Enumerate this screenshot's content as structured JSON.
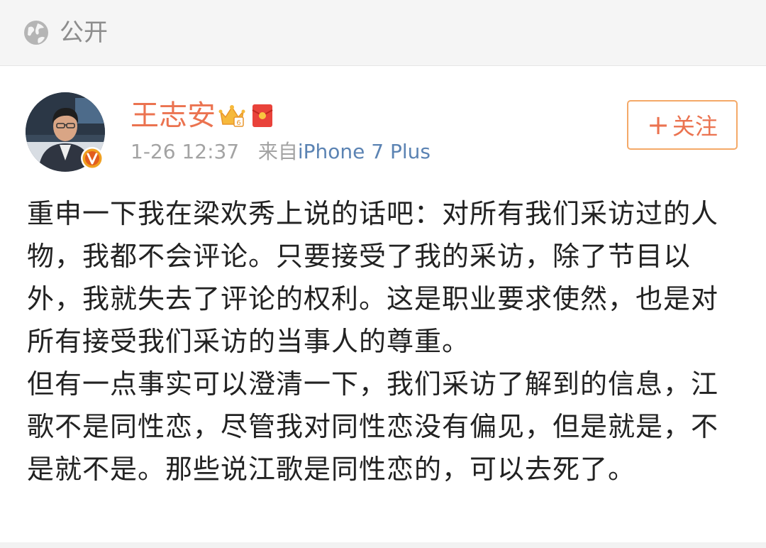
{
  "header": {
    "visibility_label": "公开",
    "visibility_icon": "globe-icon"
  },
  "post": {
    "author_name": "王志安",
    "author_badges": [
      "crown-icon",
      "red-packet-icon"
    ],
    "verified_badge": "verified-v-icon",
    "time": "1-26 12:37",
    "source_prefix": "来自",
    "source_device": "iPhone 7 Plus",
    "follow_label": "关注",
    "paragraph_1": "重申一下我在梁欢秀上说的话吧：对所有我们采访过的人物，我都不会评论。只要接受了我的采访，除了节目以外，我就失去了评论的权利。这是职业要求使然，也是对所有接受我们采访的当事人的尊重。",
    "paragraph_2": "但有一点事实可以澄清一下，我们采访了解到的信息，江歌不是同性恋，尽管我对同性恋没有偏见，但是就是，不是就不是。那些说江歌是同性恋的，可以去死了。"
  },
  "colors": {
    "author_name": "#eb7350",
    "source_link": "#5b83b3",
    "follow_border": "#f4a968",
    "verified_badge": "#f0a020"
  }
}
